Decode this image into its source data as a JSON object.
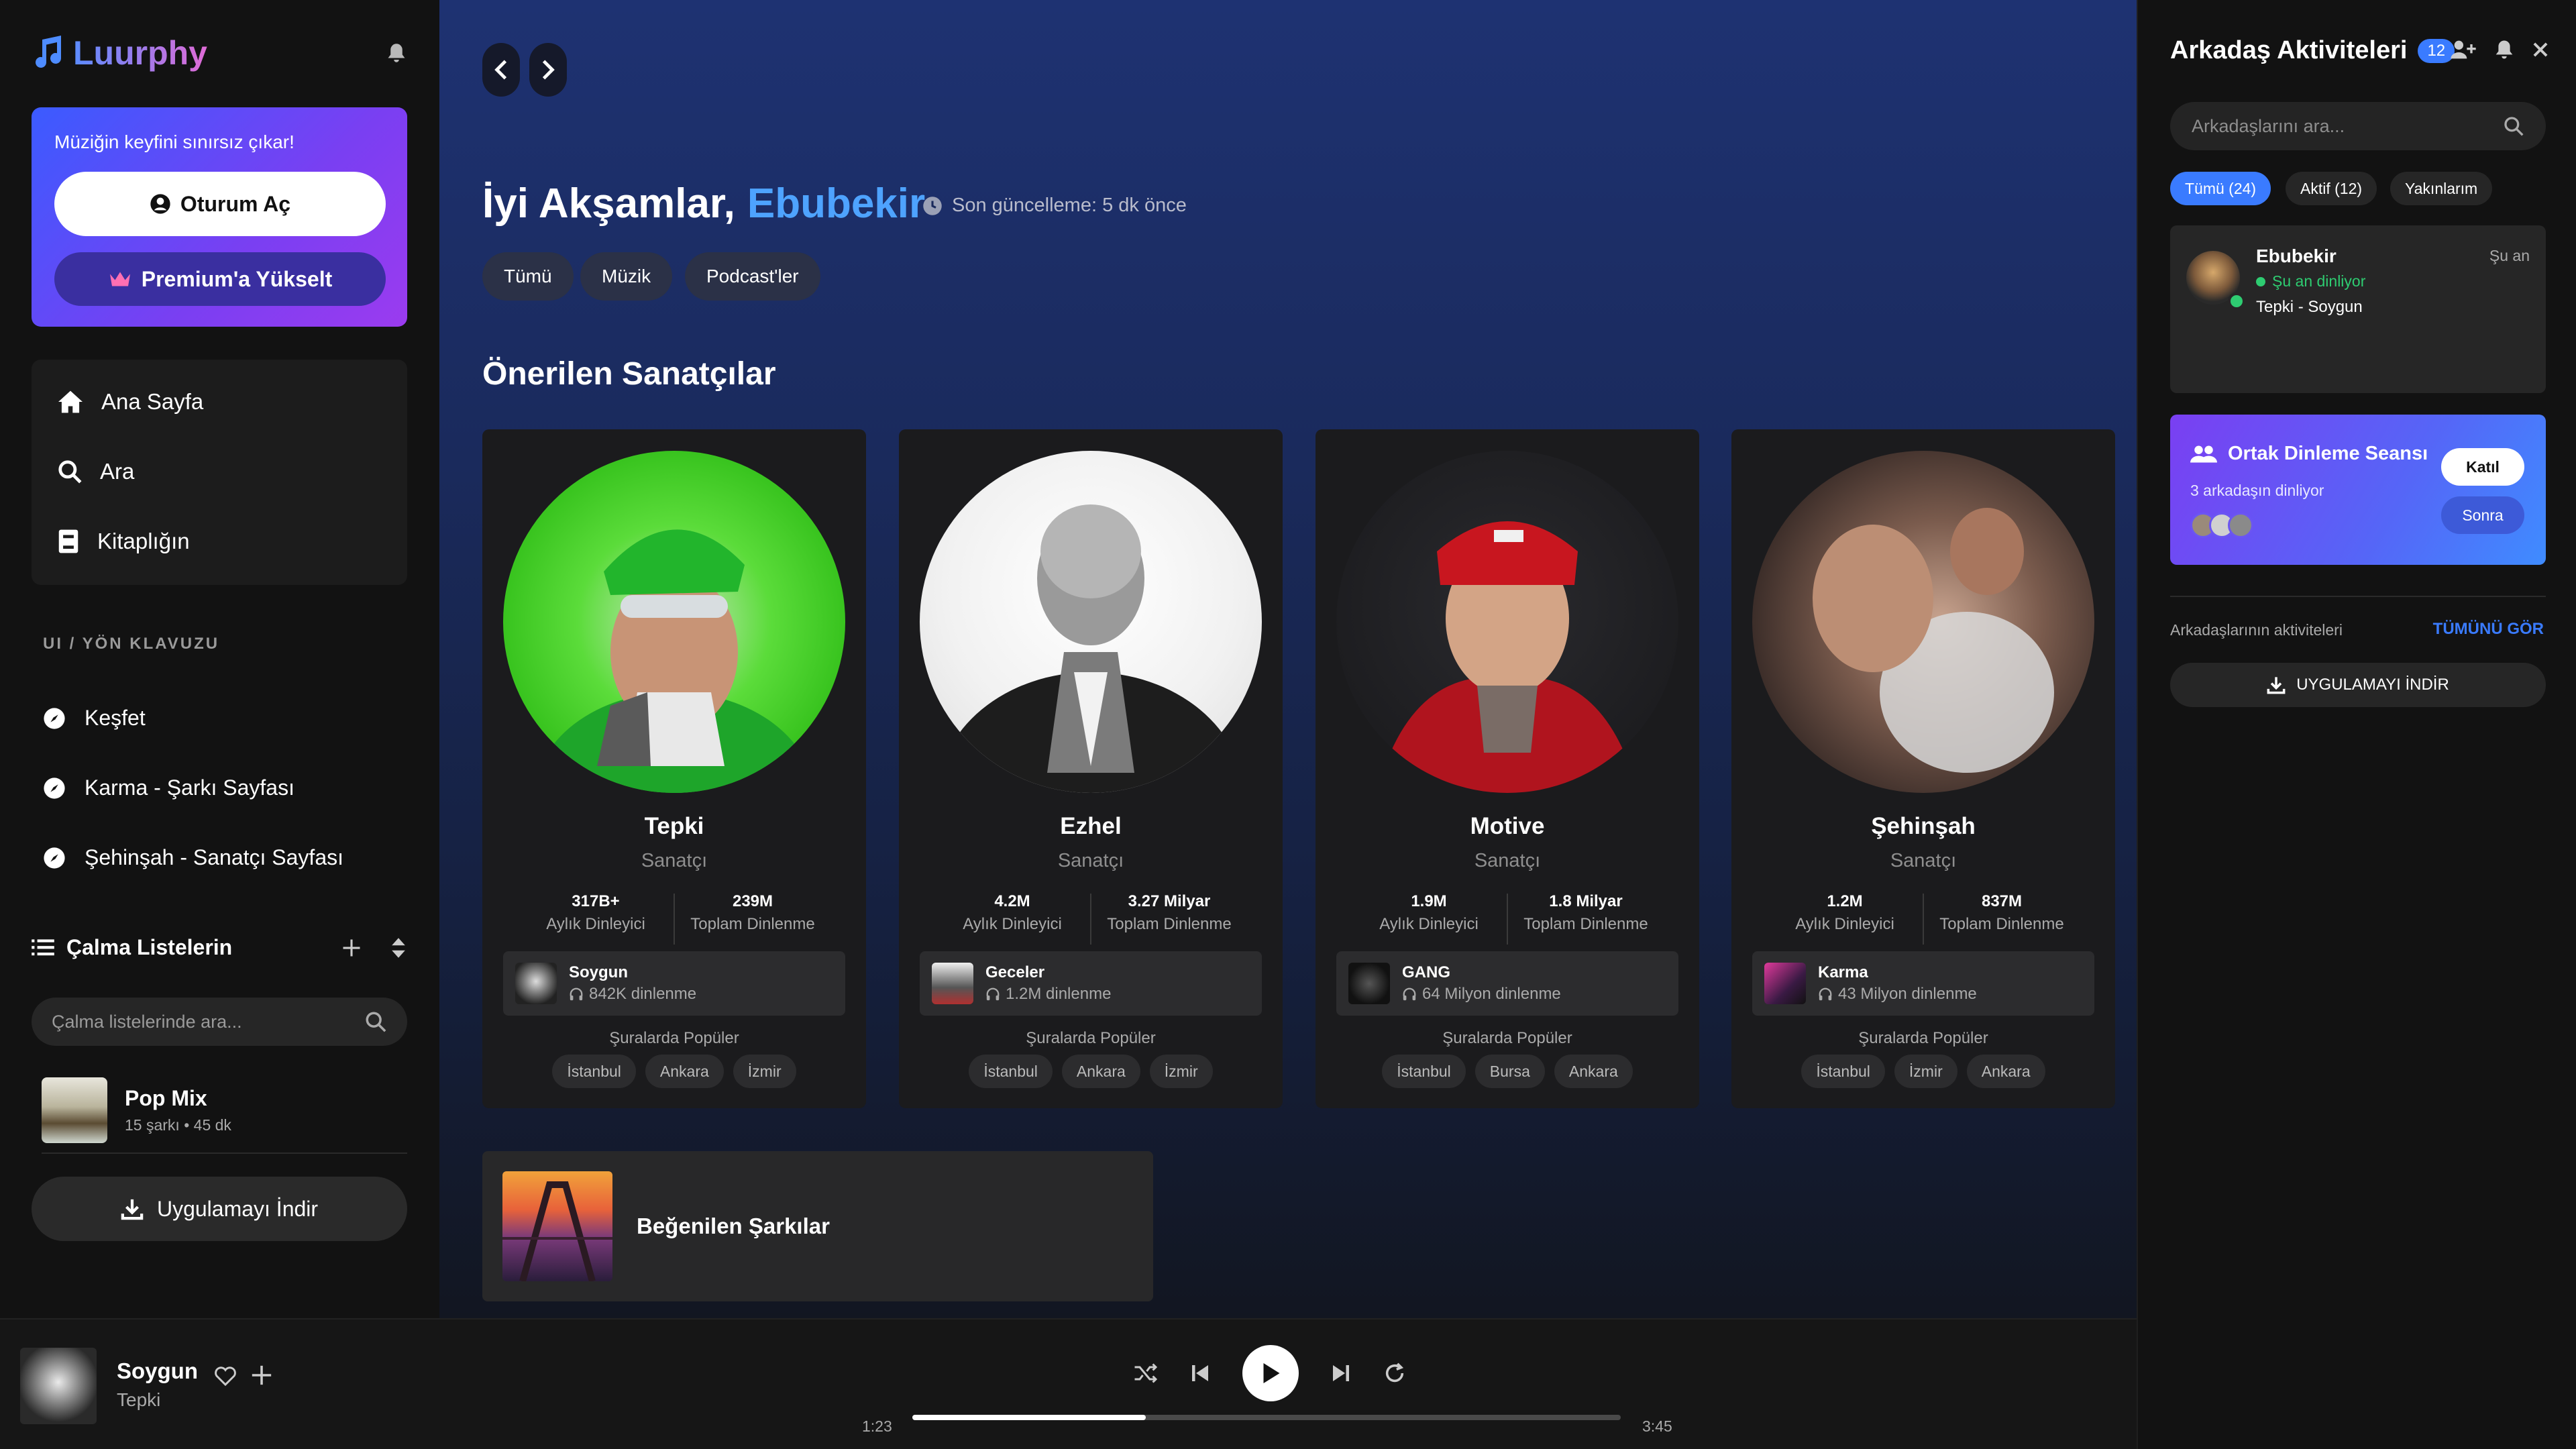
{
  "app": {
    "logo_text": "Luurphy"
  },
  "promo": {
    "tagline": "Müziğin keyfini sınırsız çıkar!",
    "login_label": "Oturum Aç",
    "premium_label": "Premium'a Yükselt"
  },
  "nav": {
    "items": [
      {
        "label": "Ana Sayfa",
        "icon": "home-icon"
      },
      {
        "label": "Ara",
        "icon": "search-icon"
      },
      {
        "label": "Kitaplığın",
        "icon": "library-icon"
      }
    ]
  },
  "guide": {
    "section_label": "UI / YÖN KLAVUZU",
    "items": [
      {
        "label": "Keşfet"
      },
      {
        "label": "Karma - Şarkı Sayfası"
      },
      {
        "label": "Şehinşah - Sanatçı Sayfası"
      }
    ]
  },
  "playlists": {
    "title": "Çalma Listelerin",
    "search_placeholder": "Çalma listelerinde ara...",
    "items": [
      {
        "name": "Pop Mix",
        "meta": "15 şarkı • 45 dk"
      }
    ],
    "download_label": "Uygulamayı İndir"
  },
  "main": {
    "greeting": "İyi Akşamlar,",
    "user_name": "Ebubekir",
    "updated": "Son güncelleme: 5 dk önce",
    "filters": [
      "Tümü",
      "Müzik",
      "Podcast'ler"
    ],
    "section_title": "Önerilen Sanatçılar",
    "popular_label": "Şuralarda Popüler",
    "artists": [
      {
        "name": "Tepki",
        "role": "Sanatçı",
        "monthly": "317B+",
        "monthly_label": "Aylık Dinleyici",
        "total": "239M",
        "total_label": "Toplam Dinlenme",
        "song": "Soygun",
        "plays": "842K dinlenme",
        "cities": [
          "İstanbul",
          "Ankara",
          "İzmir"
        ]
      },
      {
        "name": "Ezhel",
        "role": "Sanatçı",
        "monthly": "4.2M",
        "monthly_label": "Aylık Dinleyici",
        "total": "3.27 Milyar",
        "total_label": "Toplam Dinlenme",
        "song": "Geceler",
        "plays": "1.2M dinlenme",
        "cities": [
          "İstanbul",
          "Ankara",
          "İzmir"
        ]
      },
      {
        "name": "Motive",
        "role": "Sanatçı",
        "monthly": "1.9M",
        "monthly_label": "Aylık Dinleyici",
        "total": "1.8 Milyar",
        "total_label": "Toplam Dinlenme",
        "song": "GANG",
        "plays": "64 Milyon dinlenme",
        "cities": [
          "İstanbul",
          "Bursa",
          "Ankara"
        ]
      },
      {
        "name": "Şehinşah",
        "role": "Sanatçı",
        "monthly": "1.2M",
        "monthly_label": "Aylık Dinleyici",
        "total": "837M",
        "total_label": "Toplam Dinlenme",
        "song": "Karma",
        "plays": "43 Milyon dinlenme",
        "cities": [
          "İstanbul",
          "İzmir",
          "Ankara"
        ]
      }
    ],
    "liked_title": "Beğenilen Şarkılar"
  },
  "friends": {
    "title": "Arkadaş Aktiviteleri",
    "badge": "12",
    "search_placeholder": "Arkadaşlarını ara...",
    "tabs": [
      "Tümü (24)",
      "Aktif (12)",
      "Yakınlarım"
    ],
    "friend": {
      "name": "Ebubekir",
      "status": "Şu an dinliyor",
      "track": "Tepki - Soygun",
      "time": "Şu an"
    },
    "session": {
      "title": "Ortak Dinleme Seansı",
      "subtitle": "3 arkadaşın dinliyor",
      "join_label": "Katıl",
      "later_label": "Sonra"
    },
    "activity_label": "Arkadaşlarının aktiviteleri",
    "see_all": "TÜMÜNÜ GÖR",
    "download_label": "UYGULAMAYI İNDİR"
  },
  "player": {
    "title": "Soygun",
    "artist": "Tepki",
    "elapsed": "1:23",
    "duration": "3:45",
    "progress": 0.33
  },
  "colors": {
    "accent": "#3a7bff",
    "active_green": "#2ecc71",
    "promo_start": "#3b5bff",
    "promo_end": "#9b3bef"
  }
}
